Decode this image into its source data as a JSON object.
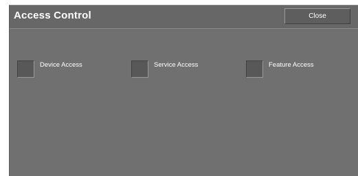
{
  "header": {
    "title": "Access Control",
    "close_label": "Close"
  },
  "options": [
    {
      "label": "Device Access"
    },
    {
      "label": "Service Access"
    },
    {
      "label": "Feature Access"
    }
  ]
}
